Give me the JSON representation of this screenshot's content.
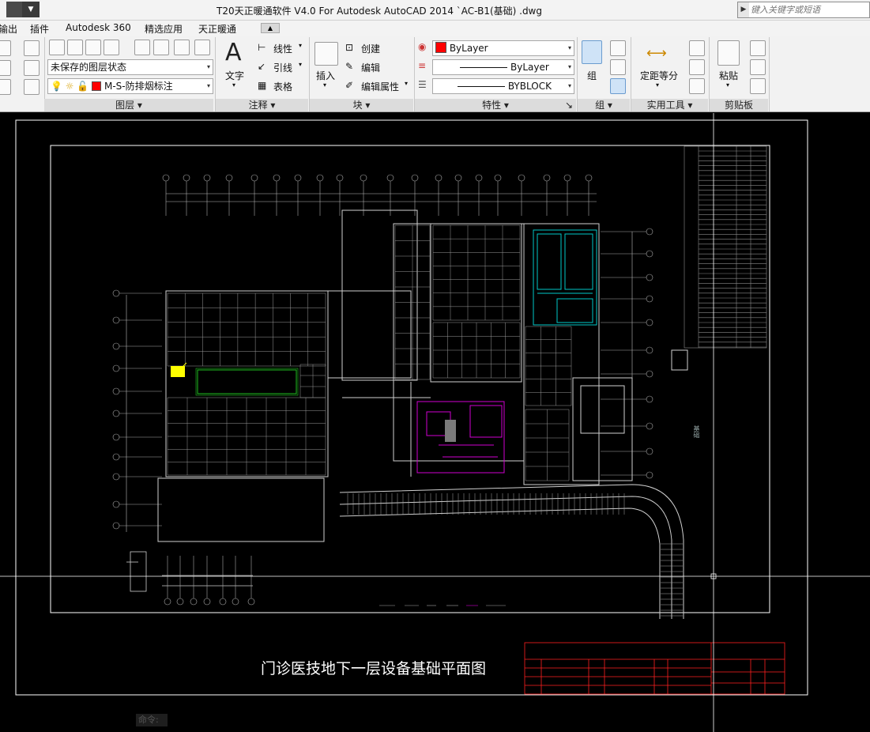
{
  "titlebar": {
    "title": "T20天正暖通软件 V4.0 For Autodesk AutoCAD 2014    `AC-B1(基础) .dwg",
    "search_placeholder": "键入关键字或短语",
    "dropdown_glyph": "▼",
    "search_arrow": "▶"
  },
  "tabs": {
    "items": [
      "输出",
      "插件",
      "Autodesk 360",
      "精选应用",
      "天正暖通"
    ],
    "dropdown": "▲"
  },
  "ribbon": {
    "layer_panel": {
      "label": "图层",
      "layer_state": "未保存的图层状态",
      "current_layer": "M-S-防排烟标注"
    },
    "annotation_panel": {
      "label": "注释",
      "text_button": "文字",
      "linear": "线性",
      "leader": "引线",
      "table": "表格",
      "text_glyph": "A"
    },
    "block_panel": {
      "label": "块",
      "insert": "插入",
      "create": "创建",
      "edit": "编辑",
      "edit_attributes": "编辑属性"
    },
    "properties_panel": {
      "label": "特性",
      "color": "ByLayer",
      "linetype": "ByLayer",
      "lineweight": "BYBLOCK"
    },
    "group_panel": {
      "label": "组",
      "group_button": "组"
    },
    "utilities_panel": {
      "label": "实用工具",
      "measure": "定距等分"
    },
    "clipboard_panel": {
      "label": "剪贴板",
      "paste": "粘贴"
    },
    "dropdown_glyph": "▾",
    "corner_glyph": "↘"
  },
  "drawing": {
    "sheet_title": "门诊医技地下一层设备基础平面图",
    "command_prompt": "命令:",
    "side_label": "基础"
  },
  "colors": {
    "background": "#000000",
    "ribbon": "#f2f2f2",
    "frame": "#ffffff",
    "title_block": "#ff2020",
    "highlight_yellow": "#ffff00",
    "cyan_zone": "#00c8c8",
    "magenta_zone": "#d000d0",
    "green_zone": "#20c020"
  }
}
